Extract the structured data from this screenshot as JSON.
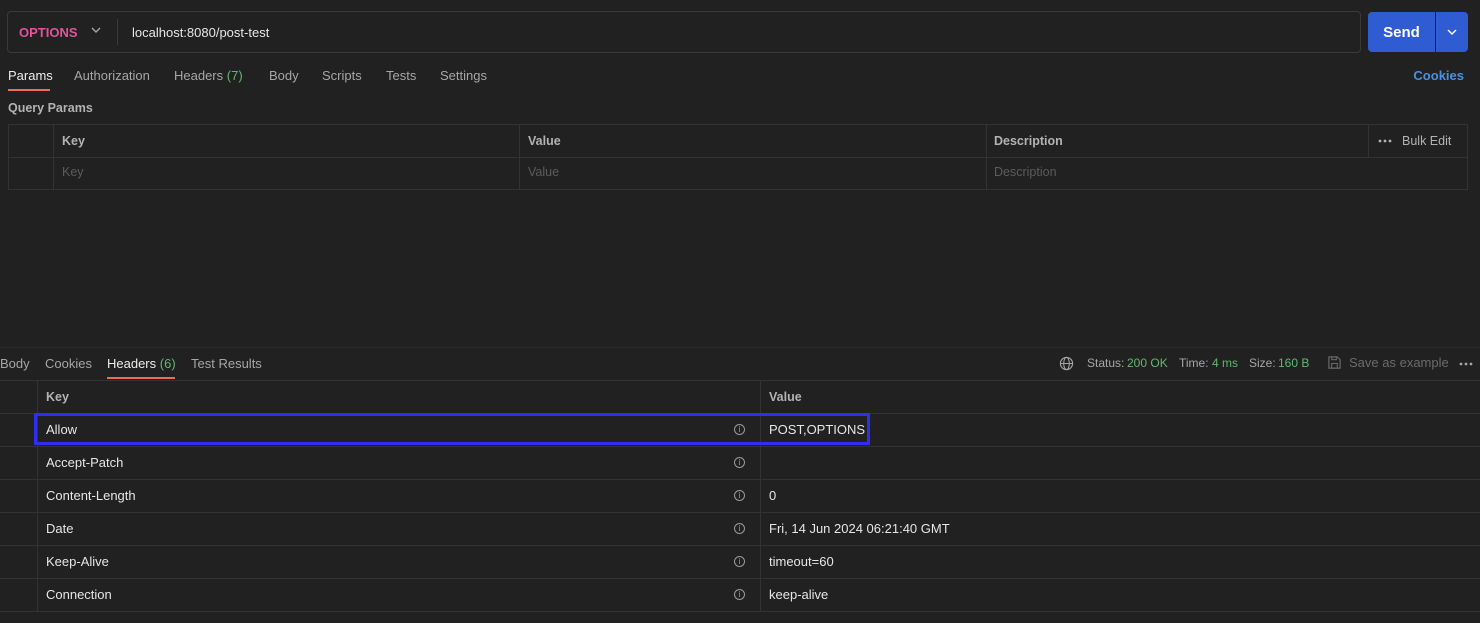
{
  "request": {
    "method": "OPTIONS",
    "url": "localhost:8080/post-test",
    "send_label": "Send"
  },
  "request_tabs": {
    "params": "Params",
    "authorization": "Authorization",
    "headers": "Headers",
    "headers_count": "(7)",
    "body": "Body",
    "scripts": "Scripts",
    "tests": "Tests",
    "settings": "Settings",
    "cookies": "Cookies"
  },
  "query_params": {
    "title": "Query Params",
    "columns": [
      "Key",
      "Value",
      "Description"
    ],
    "placeholders": [
      "Key",
      "Value",
      "Description"
    ],
    "bulk_edit": "Bulk Edit"
  },
  "response_tabs": {
    "body": "Body",
    "cookies": "Cookies",
    "headers": "Headers",
    "headers_count": "(6)",
    "test_results": "Test Results"
  },
  "response_status": {
    "status_label": "Status:",
    "status_value": "200 OK",
    "time_label": "Time:",
    "time_value": "4 ms",
    "size_label": "Size:",
    "size_value": "160 B",
    "save_example": "Save as example"
  },
  "response_headers": {
    "columns": [
      "Key",
      "Value"
    ],
    "rows": [
      {
        "key": "Allow",
        "value": "POST,OPTIONS"
      },
      {
        "key": "Accept-Patch",
        "value": ""
      },
      {
        "key": "Content-Length",
        "value": "0"
      },
      {
        "key": "Date",
        "value": "Fri, 14 Jun 2024 06:21:40 GMT"
      },
      {
        "key": "Keep-Alive",
        "value": "timeout=60"
      },
      {
        "key": "Connection",
        "value": "keep-alive"
      }
    ]
  },
  "colors": {
    "method": "#e0559a",
    "accent": "#e8734a",
    "send": "#2f5bd3",
    "status_green": "#5fb970",
    "highlight": "#2f2ff0"
  }
}
